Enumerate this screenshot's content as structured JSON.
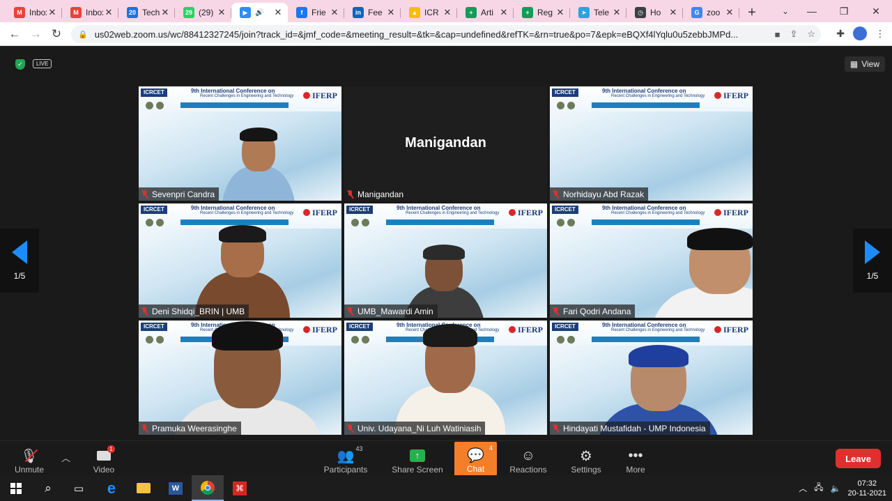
{
  "browser": {
    "tabs": [
      {
        "title": "Inbox",
        "favicon": "gmail-icon",
        "color": "#ea4335",
        "glyph": "M"
      },
      {
        "title": "Inbox",
        "favicon": "gmail-icon",
        "color": "#ea4335",
        "glyph": "M"
      },
      {
        "title": "Tech",
        "favicon": "calendar-icon",
        "color": "#1a73e8",
        "glyph": "20"
      },
      {
        "title": "(29)",
        "favicon": "whatsapp-icon",
        "color": "#25d366",
        "glyph": "29"
      },
      {
        "title": "",
        "favicon": "zoom-icon",
        "color": "#2d8cff",
        "glyph": "▶",
        "active": true,
        "audio": "🔊"
      },
      {
        "title": "Frie",
        "favicon": "facebook-icon",
        "color": "#1877f2",
        "glyph": "f"
      },
      {
        "title": "Fee",
        "favicon": "linkedin-icon",
        "color": "#0a66c2",
        "glyph": "in"
      },
      {
        "title": "ICR",
        "favicon": "drive-icon",
        "color": "#fbbc04",
        "glyph": "▲"
      },
      {
        "title": "Arti",
        "favicon": "sheets-icon",
        "color": "#0f9d58",
        "glyph": "+"
      },
      {
        "title": "Reg",
        "favicon": "sheets-icon",
        "color": "#0f9d58",
        "glyph": "+"
      },
      {
        "title": "Tele",
        "favicon": "telegram-icon",
        "color": "#2aa3df",
        "glyph": "➤"
      },
      {
        "title": "Ho",
        "favicon": "clock-icon",
        "color": "#3c4043",
        "glyph": "◷"
      },
      {
        "title": "zoo",
        "favicon": "google-icon",
        "color": "#4285f4",
        "glyph": "G"
      }
    ],
    "url": "us02web.zoom.us/wc/88412327245/join?track_id=&jmf_code=&meeting_result=&tk=&cap=undefined&refTK=&rn=true&po=7&epk=eBQXf4lYqlu0u5zebbJMPd..."
  },
  "zoom": {
    "live_label": "LIVE",
    "view_label": "View",
    "page_indicator": "1/5",
    "conference": {
      "logo": "ICRCET",
      "title": "9th International Conference on",
      "subtitle": "Recent Challenges in Engineering and Technology",
      "org": "IFERP"
    },
    "participants": [
      {
        "name": "Sevenpri Candra",
        "video": true
      },
      {
        "name": "Manigandan",
        "video": false
      },
      {
        "name": "Norhidayu Abd Razak",
        "video": true
      },
      {
        "name": "Deni Shidqi_BRIN | UMB",
        "video": true
      },
      {
        "name": "UMB_Mawardi Amin",
        "video": true
      },
      {
        "name": "Fari Qodri Andana",
        "video": true
      },
      {
        "name": "Pramuka Weerasinghe",
        "video": true
      },
      {
        "name": "Univ. Udayana_Ni Luh Watiniasih",
        "video": true
      },
      {
        "name": "Hindayati Mustafidah - UMP Indonesia",
        "video": true
      }
    ],
    "toolbar": {
      "unmute": "Unmute",
      "video": "Video",
      "video_badge": "1",
      "participants": "Participants",
      "participants_count": "43",
      "share": "Share Screen",
      "chat": "Chat",
      "chat_count": "4",
      "reactions": "Reactions",
      "settings": "Settings",
      "more": "More",
      "leave": "Leave"
    }
  },
  "taskbar": {
    "time": "07:32",
    "date": "20-11-2021"
  }
}
